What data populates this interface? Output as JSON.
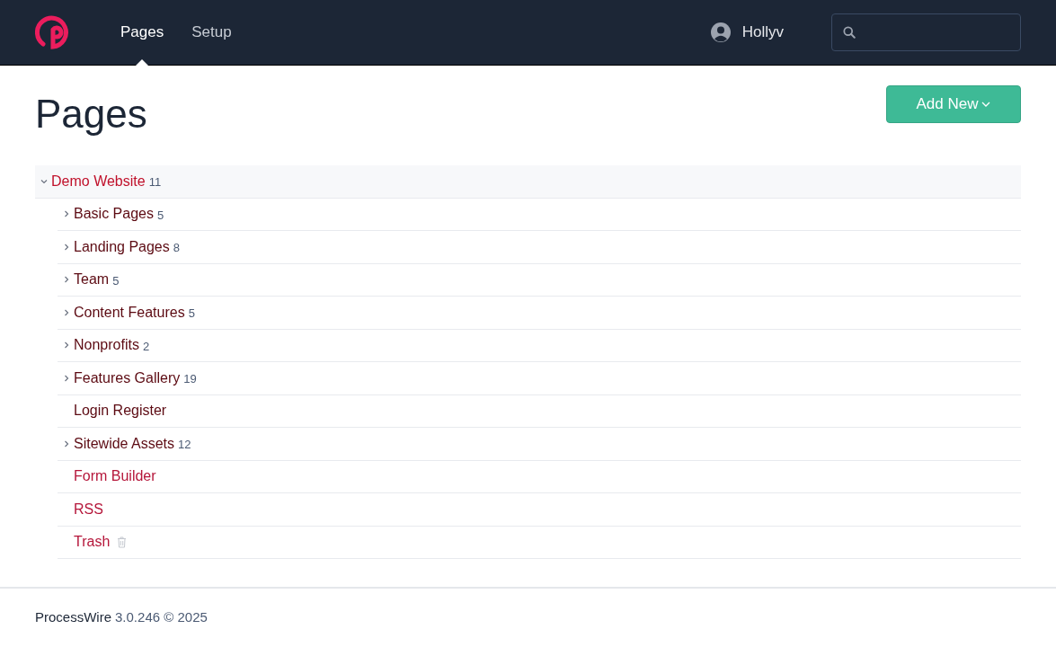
{
  "nav": {
    "tabs": [
      {
        "label": "Pages",
        "selected": true
      },
      {
        "label": "Setup",
        "selected": false
      }
    ],
    "user": "Hollyv"
  },
  "title": "Pages",
  "add_button": "Add New",
  "tree": [
    {
      "label": "Demo Website",
      "count": "11",
      "kind": "root",
      "expanded": true,
      "children": [
        {
          "label": "Basic Pages",
          "count": "5",
          "kind": "page",
          "expanded": false
        },
        {
          "label": "Landing Pages",
          "count": "8",
          "kind": "page",
          "expanded": false
        },
        {
          "label": "Team",
          "count": "5",
          "kind": "page",
          "expanded": false
        },
        {
          "label": "Content Features",
          "count": "5",
          "kind": "page",
          "expanded": false
        },
        {
          "label": "Nonprofits",
          "count": "2",
          "kind": "page",
          "expanded": false
        },
        {
          "label": "Features Gallery",
          "count": "19",
          "kind": "page",
          "expanded": false
        },
        {
          "label": "Login Register",
          "kind": "page"
        },
        {
          "label": "Sitewide Assets",
          "count": "12",
          "kind": "page",
          "expanded": false
        },
        {
          "label": "Form Builder",
          "kind": "system"
        },
        {
          "label": "RSS",
          "kind": "system"
        },
        {
          "label": "Trash",
          "kind": "trash"
        }
      ]
    }
  ],
  "footer": {
    "brand": "ProcessWire",
    "version": "3.0.246 © 2025"
  }
}
